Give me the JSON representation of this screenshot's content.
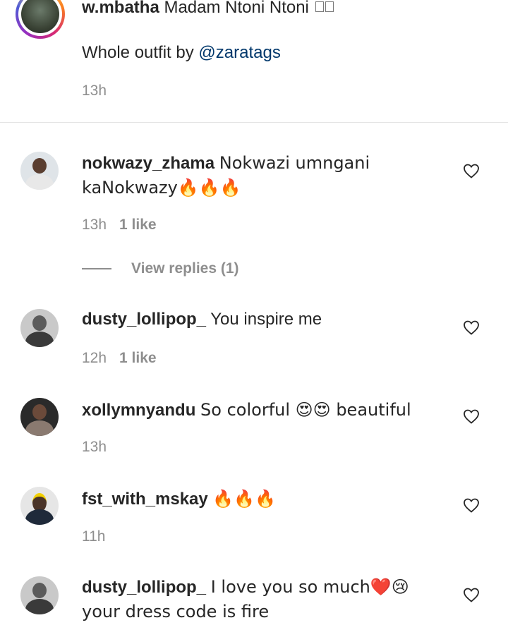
{
  "caption": {
    "username": "w.mbatha",
    "text": "Madam Ntoni Ntoni",
    "body_prefix": "Whole outfit by ",
    "mention": "@zaratags",
    "time": "13h"
  },
  "view_replies_label": "View replies (1)",
  "comments": [
    {
      "username": "nokwazy_zhama",
      "text": "Nokwazi umngani kaNokwazy🔥🔥🔥",
      "time": "13h",
      "likes": "1 like"
    },
    {
      "username": "dusty_lollipop_",
      "text": "You inspire me",
      "time": "12h",
      "likes": "1 like"
    },
    {
      "username": "xollymnyandu",
      "text": "So colorful 😍😍 beautiful",
      "time": "13h",
      "likes": ""
    },
    {
      "username": "fst_with_mskay",
      "text": "🔥🔥🔥",
      "time": "11h",
      "likes": ""
    },
    {
      "username": "dusty_lollipop_",
      "text": "I love you so much❤️😢 your dress code is fire",
      "time": "",
      "likes": ""
    }
  ]
}
